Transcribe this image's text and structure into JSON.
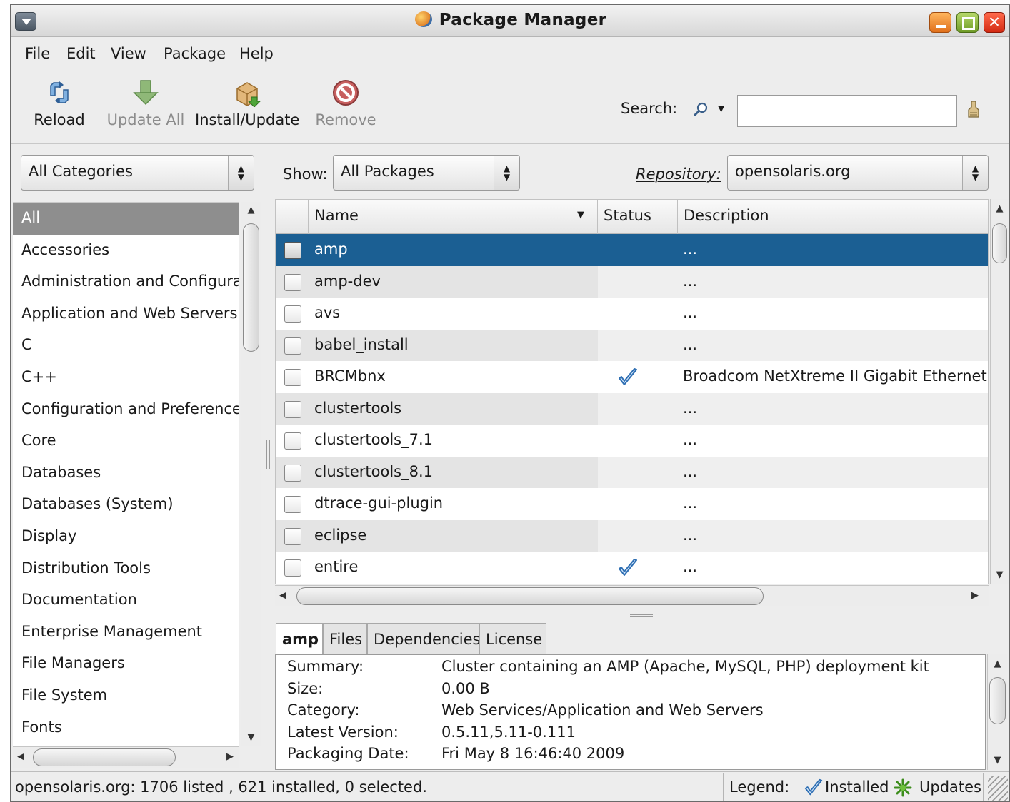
{
  "window": {
    "title": "Package Manager"
  },
  "menu": [
    "File",
    "Edit",
    "View",
    "Package",
    "Help"
  ],
  "toolbar": {
    "reload": "Reload",
    "update_all": "Update All",
    "install_update": "Install/Update",
    "remove": "Remove",
    "search_label": "Search:",
    "search_value": "",
    "search_placeholder": ""
  },
  "categories": {
    "selected": "All Categories",
    "items": [
      "All",
      "Accessories",
      "Administration and Configurat",
      "Application and Web Servers",
      "C",
      "C++",
      "Configuration and Preferences",
      "Core",
      "Databases",
      "Databases (System)",
      "Display",
      "Distribution Tools",
      "Documentation",
      "Enterprise Management",
      "File Managers",
      "File System",
      "Fonts"
    ]
  },
  "filter": {
    "show_label": "Show:",
    "show_value": "All Packages",
    "repo_label": "Repository:",
    "repo_value": "opensolaris.org"
  },
  "table": {
    "columns": [
      "Name",
      "Status",
      "Description"
    ],
    "sort_indicator": "▼",
    "rows": [
      {
        "name": "amp",
        "installed": false,
        "description": "..."
      },
      {
        "name": "amp-dev",
        "installed": false,
        "description": "..."
      },
      {
        "name": "avs",
        "installed": false,
        "description": "..."
      },
      {
        "name": "babel_install",
        "installed": false,
        "description": "..."
      },
      {
        "name": "BRCMbnx",
        "installed": true,
        "description": "Broadcom NetXtreme II Gigabit Ethernet A"
      },
      {
        "name": "clustertools",
        "installed": false,
        "description": "..."
      },
      {
        "name": "clustertools_7.1",
        "installed": false,
        "description": "..."
      },
      {
        "name": "clustertools_8.1",
        "installed": false,
        "description": "..."
      },
      {
        "name": "dtrace-gui-plugin",
        "installed": false,
        "description": "..."
      },
      {
        "name": "eclipse",
        "installed": false,
        "description": "..."
      },
      {
        "name": "entire",
        "installed": true,
        "description": "..."
      }
    ]
  },
  "tabs": [
    "amp",
    "Files",
    "Dependencies",
    "License"
  ],
  "details": {
    "labels": [
      "Summary:",
      "Size:",
      "Category:",
      "Latest Version:",
      "Packaging Date:"
    ],
    "values": [
      "Cluster containing an AMP (Apache, MySQL, PHP) deployment kit",
      "0.00 B",
      "Web Services/Application and Web Servers",
      "0.5.11,5.11-0.111",
      "Fri May  8 16:46:40 2009"
    ]
  },
  "status": {
    "text": "opensolaris.org: 1706 listed , 621 installed, 0 selected.",
    "legend_label": "Legend:",
    "installed_label": "Installed",
    "updates_label": "Updates"
  },
  "colors": {
    "selection": "#1b5f93",
    "check_blue": "#2f6fb3",
    "update_green": "#3c8d1b"
  },
  "icons": [
    "reload-icon",
    "update-all-icon",
    "install-update-icon",
    "remove-icon",
    "search-icon",
    "clear-search-icon",
    "installed-check-icon",
    "updates-star-icon"
  ]
}
